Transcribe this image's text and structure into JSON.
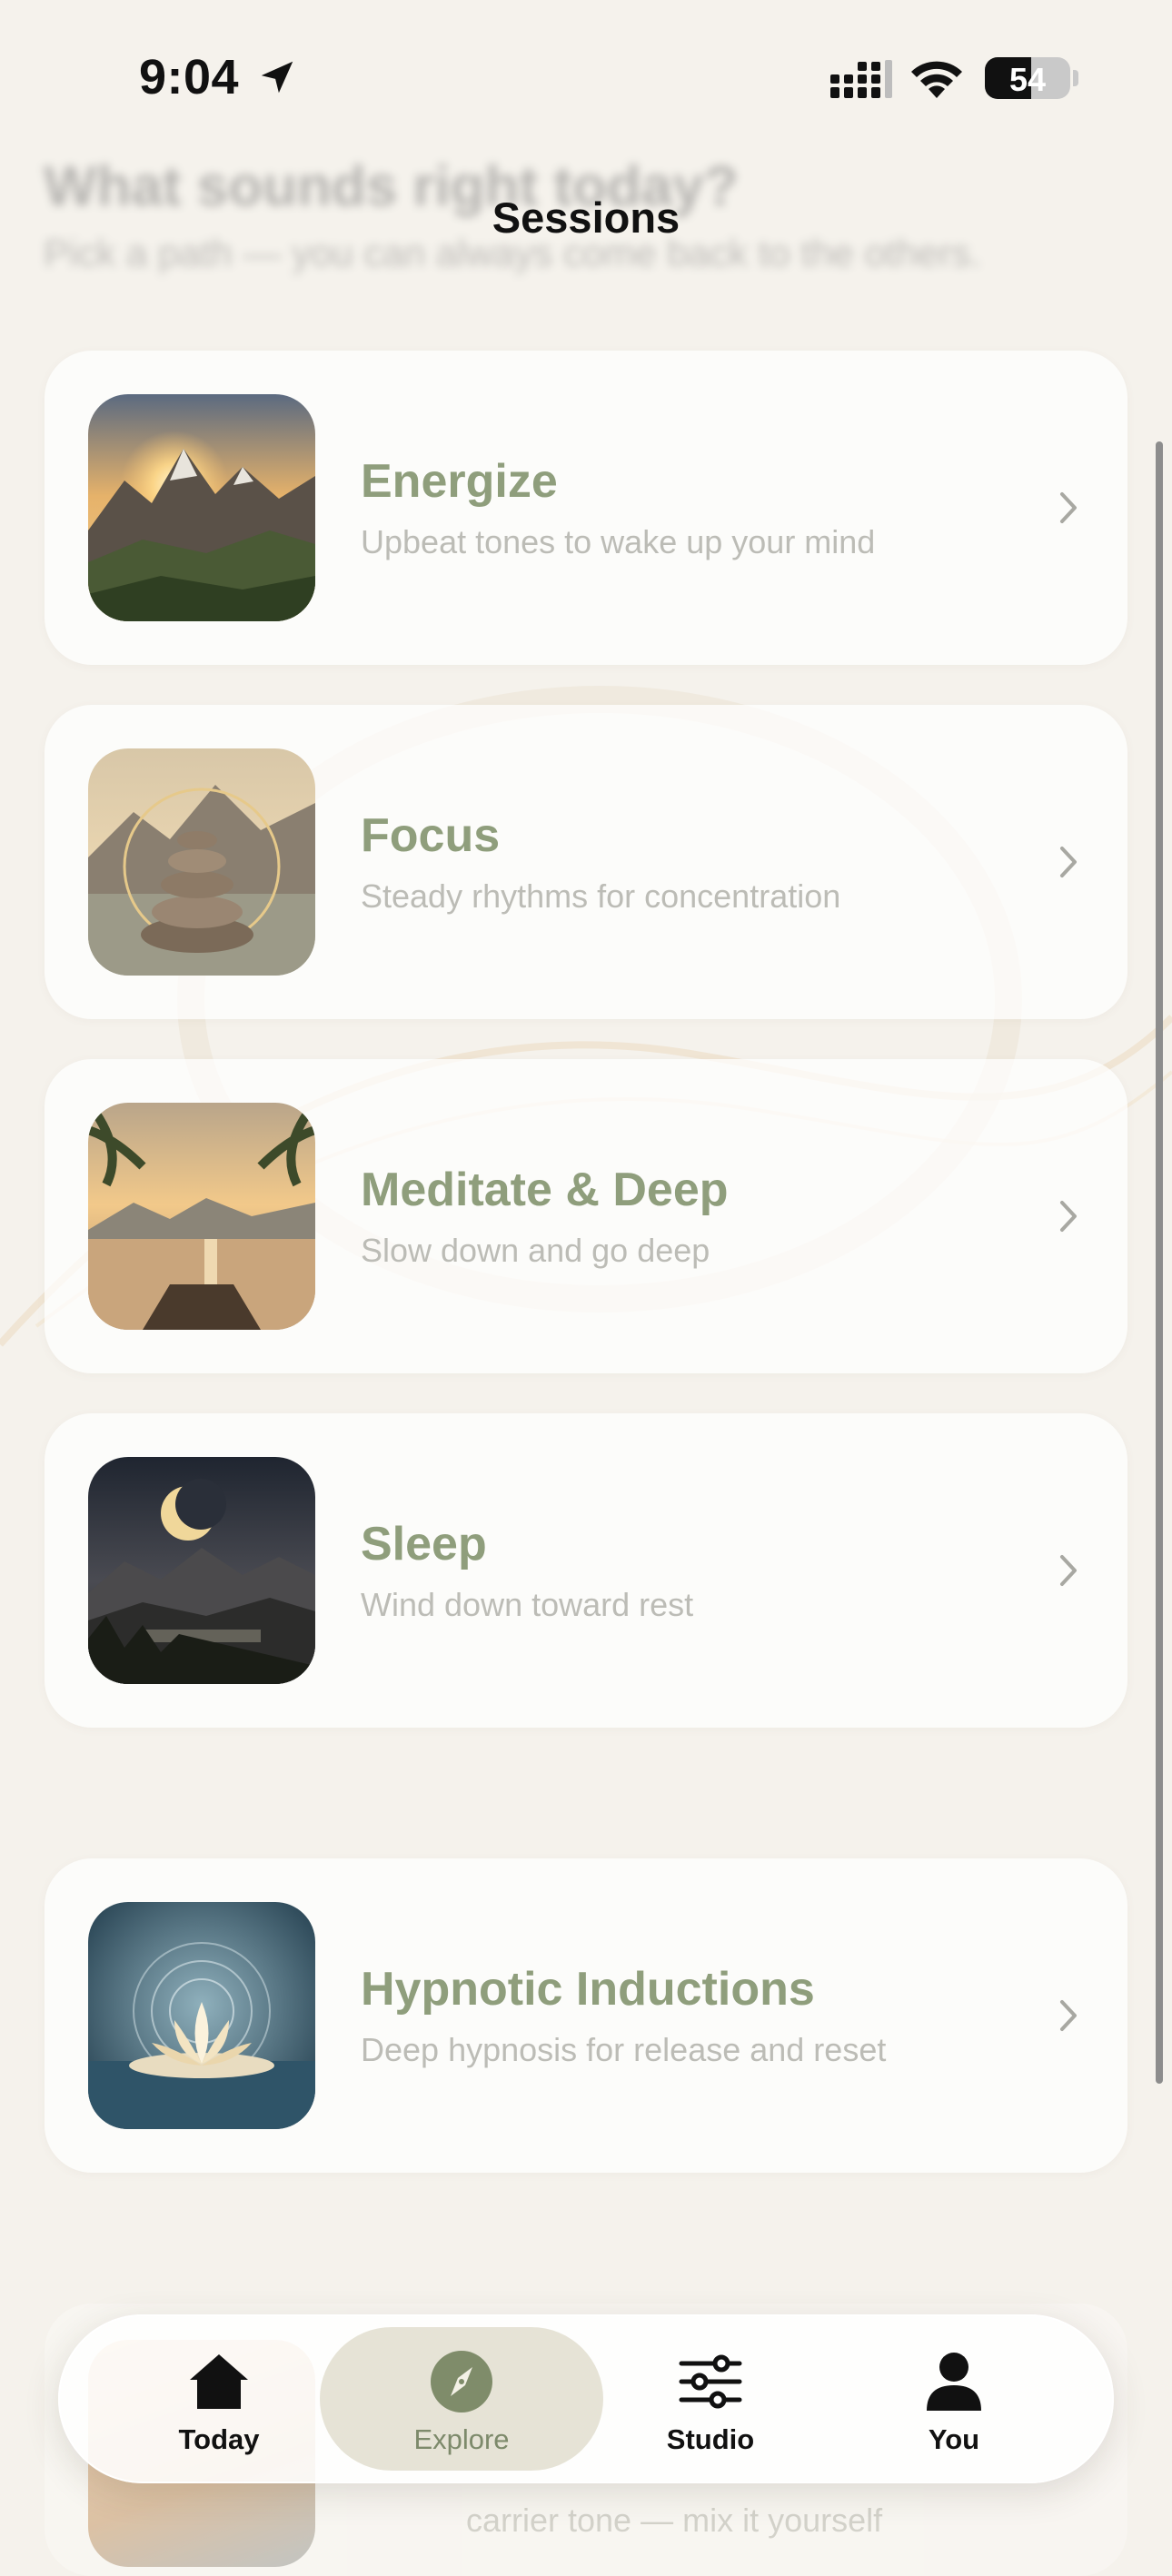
{
  "status_bar": {
    "time": "9:04",
    "battery": "54",
    "battery_level_percent": 54
  },
  "header": {
    "hidden_heading": "What sounds right today?",
    "hidden_subheading": "Pick a path — you can always come back to the others.",
    "title": "Sessions"
  },
  "sessions": [
    {
      "title": "Energize",
      "subtitle": "Upbeat tones to wake up your mind",
      "image": "mountain-sunrise"
    },
    {
      "title": "Focus",
      "subtitle": "Steady rhythms for concentration",
      "image": "stacked-stones"
    },
    {
      "title": "Meditate & Deep",
      "subtitle": "Slow down and go deep",
      "image": "lake-dock-sunset"
    },
    {
      "title": "Sleep",
      "subtitle": "Wind down toward rest",
      "image": "moon-mountains"
    },
    {
      "title": "Hypnotic Inductions",
      "subtitle": "Deep hypnosis for release and reset",
      "image": "lotus-water"
    }
  ],
  "partially_hidden_card": {
    "subtitle": "carrier tone — mix it yourself"
  },
  "tab_bar": {
    "tabs": [
      {
        "label": "Today",
        "icon": "home-icon"
      },
      {
        "label": "Explore",
        "icon": "compass-icon",
        "active": true
      },
      {
        "label": "Studio",
        "icon": "sliders-icon"
      },
      {
        "label": "You",
        "icon": "person-icon"
      }
    ]
  },
  "colors": {
    "accent": "#8f9e7c",
    "background": "#f5f2ec",
    "subtitle": "#bcbcb6"
  }
}
